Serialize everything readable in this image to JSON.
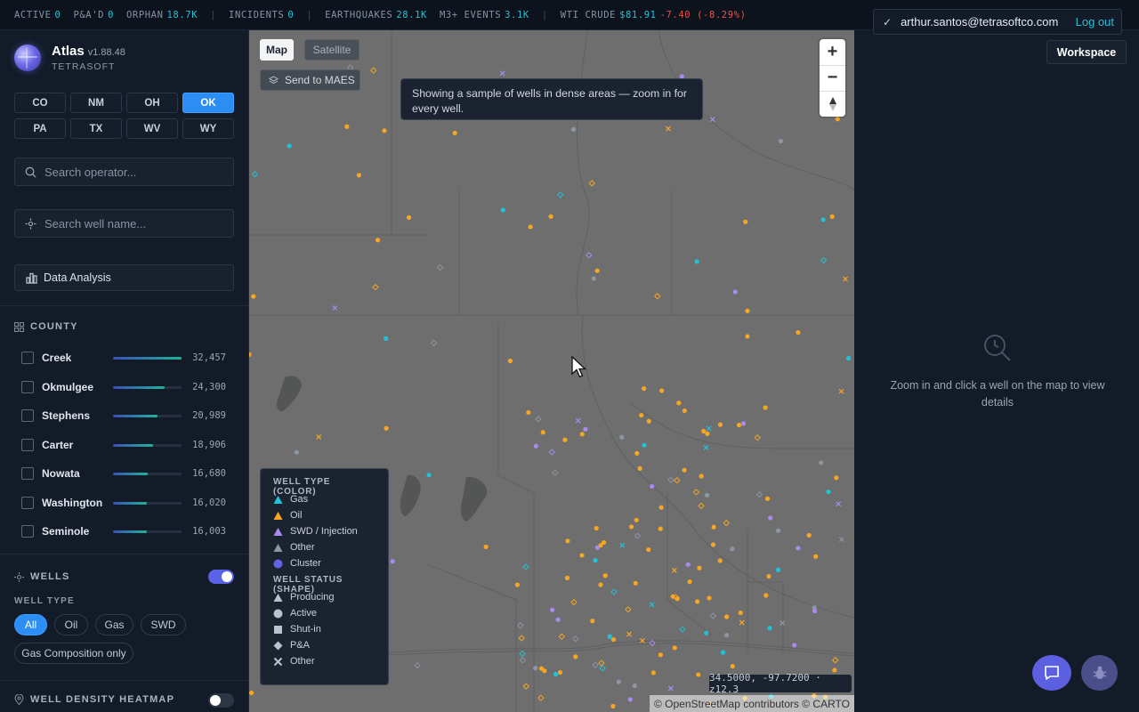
{
  "ticker": {
    "active_label": "ACTIVE",
    "active_value": "0",
    "pa_label": "P&A'D",
    "pa_value": "0",
    "orphan_label": "ORPHAN",
    "orphan_value": "18.7K",
    "incidents_label": "INCIDENTS",
    "incidents_value": "0",
    "earthquakes_label": "EARTHQUAKES",
    "earthquakes_value": "28.1K",
    "m3_label": "M3+ EVENTS",
    "m3_value": "3.1K",
    "wti_label": "WTI CRUDE",
    "wti_price": "$81.91",
    "wti_change": "-7.40 (-8.29%)",
    "separator": "|"
  },
  "brand": {
    "title": "Atlas",
    "version": "v1.88.48",
    "org": "TETRASOFT"
  },
  "states": [
    "CO",
    "NM",
    "OH",
    "OK",
    "PA",
    "TX",
    "WV",
    "WY"
  ],
  "selected_state": "OK",
  "search_operator": {
    "placeholder": "Search operator..."
  },
  "search_well": {
    "placeholder": "Search well name..."
  },
  "data_analysis_label": "Data Analysis",
  "county": {
    "heading": "COUNTY",
    "rows": [
      {
        "name": "Creek",
        "count": "32,457",
        "fraction": 1.0
      },
      {
        "name": "Okmulgee",
        "count": "24,300",
        "fraction": 0.75
      },
      {
        "name": "Stephens",
        "count": "20,989",
        "fraction": 0.65
      },
      {
        "name": "Carter",
        "count": "18,906",
        "fraction": 0.58
      },
      {
        "name": "Nowata",
        "count": "16,680",
        "fraction": 0.51
      },
      {
        "name": "Washington",
        "count": "16,020",
        "fraction": 0.49
      },
      {
        "name": "Seminole",
        "count": "16,003",
        "fraction": 0.49
      }
    ]
  },
  "wells": {
    "heading": "WELLS",
    "enabled": true,
    "type_heading": "WELL TYPE",
    "types": [
      "All",
      "Oil",
      "Gas",
      "SWD"
    ],
    "selected_type": "All",
    "gas_comp_label": "Gas Composition only"
  },
  "heatmap": {
    "heading": "WELL DENSITY HEATMAP",
    "enabled": false
  },
  "map": {
    "map_tab": "Map",
    "satellite_tab": "Satellite",
    "send_label": "Send to MAES",
    "notice": "Showing a sample of wells in dense areas — zoom in for every well.",
    "zoom_in": "+",
    "zoom_out": "−",
    "coords": "34.5000, -97.7200 · z12.3",
    "attribution": "© OpenStreetMap contributors © CARTO"
  },
  "legend": {
    "type_heading": "WELL TYPE (COLOR)",
    "types": [
      {
        "label": "Gas",
        "color": "#21c2d8"
      },
      {
        "label": "Oil",
        "color": "#f6a623"
      },
      {
        "label": "SWD / Injection",
        "color": "#a98bf0"
      },
      {
        "label": "Other",
        "color": "#8d96a3"
      },
      {
        "label": "Cluster",
        "color": "#6462e6"
      }
    ],
    "status_heading": "WELL STATUS (SHAPE)",
    "statuses": [
      "Producing",
      "Active",
      "Shut-in",
      "P&A",
      "Other"
    ]
  },
  "user": {
    "email": "arthur.santos@tetrasoftco.com",
    "logout": "Log out",
    "workspace": "Workspace"
  },
  "details": {
    "empty": "Zoom in and click a well on the map to view details"
  },
  "colors": {
    "accent": "#2c8ef5",
    "cyan": "#27c0d6",
    "oil": "#f6a623",
    "gas": "#21c2d8",
    "swd": "#a98bf0",
    "negative": "#e5534b"
  }
}
